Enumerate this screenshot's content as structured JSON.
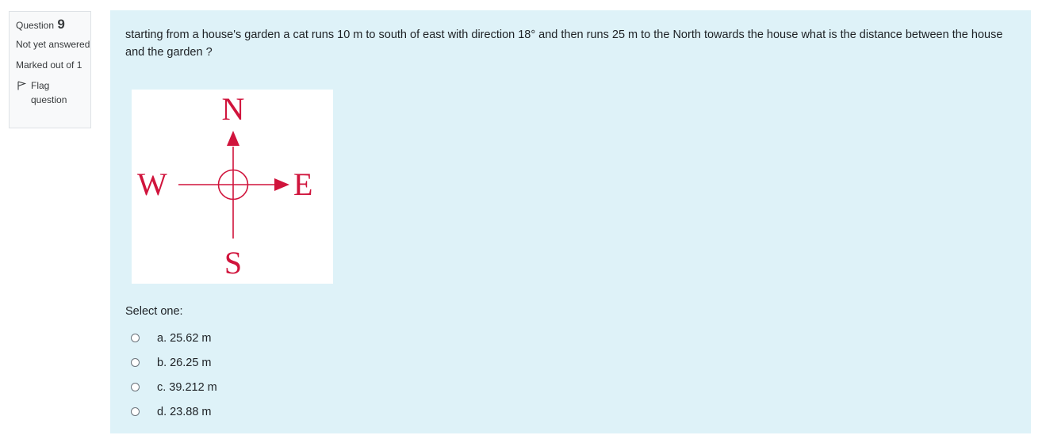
{
  "info": {
    "question_label": "Question",
    "question_number": "9",
    "state": "Not yet answered",
    "grade": "Marked out of 1",
    "flag_label": "Flag question"
  },
  "question": {
    "text": "starting from a house's garden a cat runs 10 m to south of east with direction 18° and then runs 25 m to the North towards the house what is the distance between the house and the garden ?"
  },
  "figure": {
    "north": "N",
    "south": "S",
    "east": "E",
    "west": "W",
    "color": "#d0143c"
  },
  "prompt": "Select one:",
  "answers": [
    {
      "label": "a. 25.62 m",
      "selected": false
    },
    {
      "label": "b. 26.25 m",
      "selected": false
    },
    {
      "label": "c. 39.212 m",
      "selected": false
    },
    {
      "label": "d. 23.88 m",
      "selected": false
    }
  ]
}
